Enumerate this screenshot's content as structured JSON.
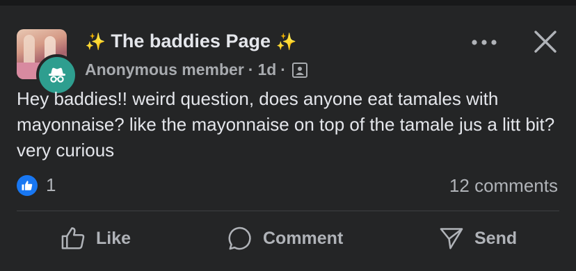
{
  "group": {
    "title": "The baddies Page",
    "sparkle": "✨"
  },
  "post": {
    "author": "Anonymous member",
    "separator": "·",
    "time": "1d",
    "text": "Hey baddies!! weird question, does anyone eat tamales with mayonnaise? like the mayonnaise on top of the tamale jus a litt bit? very curious"
  },
  "stats": {
    "reaction_count": "1",
    "comments": "12 comments"
  },
  "actions": {
    "like": "Like",
    "comment": "Comment",
    "send": "Send"
  },
  "icons": {
    "more": "more-options-icon",
    "close": "close-icon",
    "audience": "photo-frame-icon",
    "anon": "incognito-icon"
  },
  "colors": {
    "background": "#242526",
    "accent": "#1877f2",
    "anon_avatar": "#2e9e8f"
  }
}
